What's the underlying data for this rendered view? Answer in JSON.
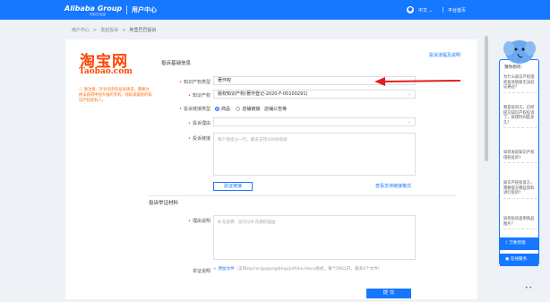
{
  "header": {
    "logo": "Alibaba Group",
    "logo_sub": "阿里巴巴集团",
    "center_title": "用户中心",
    "lang": "中文 ⌄",
    "platform_home": "平台首页"
  },
  "breadcrumb": [
    "用户中心",
    ">",
    "发起投诉",
    ">",
    "阿里巴巴投诉"
  ],
  "brand": {
    "name": "淘宝网",
    "domain": "Taobao.com",
    "tip": "ⓘ 请注意：针对淘宝的投诉请求，需要为依法获得中国大陆的专利、商标或版权的知识产权权利人。"
  },
  "sections": {
    "basic": "投诉基础信息",
    "evidence": "投诉举证材料",
    "flow_link": "投诉流程及说明"
  },
  "form": {
    "ip_type_label": "知识产权类型",
    "ip_type_value": "著作权",
    "ip_label": "知识产权",
    "ip_value": "版权知识产权(著作登记-2020-F-00100291)",
    "link_type_label": "投诉链接类型",
    "radio_options": [
      "商品",
      "店铺链接",
      "店铺公告等"
    ],
    "reason_label": "投诉理由",
    "links_label": "投诉链接",
    "links_placeholder": "每个链接占一行，最多支持300条链接",
    "verify_button": "验证链接",
    "format_link": "查看支持链接格式",
    "desc_label": "理由说明",
    "desc_placeholder": "补充说明：您可以补充侵权理由",
    "upload_label": "举证说明",
    "upload_link": "+ 添加文件",
    "upload_hint": "（支持zip/rar/jpg/png/bmp/pdf/doc/docx格式，每个5M以内，最多4个文件）",
    "submit": "提 交"
  },
  "side_panel": {
    "heading": "猜你想问:",
    "faqs": [
      "为什么知识产权侵权投诉链接无法验证通过?",
      "我是投诉方，已经提交知识产权投诉了，处理时间是多久?",
      "如何发起知识产权侵权投诉?",
      "知识产权投诉方，需要提交哪些资料进行投诉?",
      "如何投诉盗用商品图片?"
    ],
    "btn_assistant": "万象智能",
    "btn_service": "在线服务"
  },
  "colors": {
    "brand_blue": "#1677ff",
    "taobao_orange": "#ff4400",
    "arrow_red": "#e02020"
  }
}
